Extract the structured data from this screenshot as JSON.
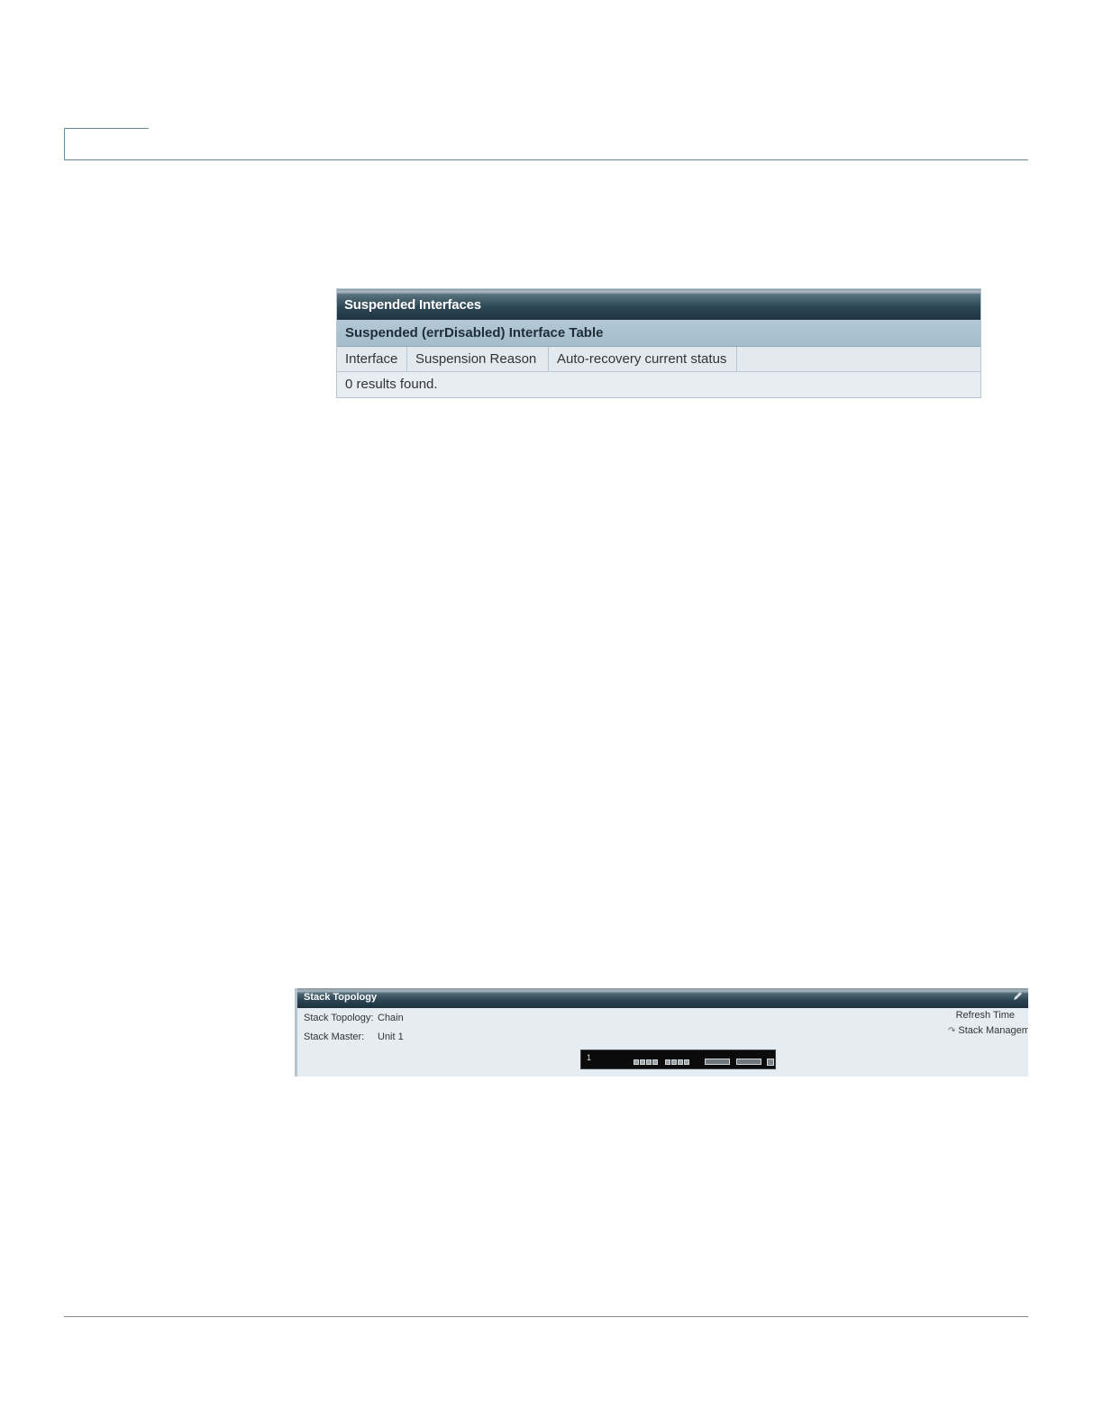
{
  "suspended_panel": {
    "title": "Suspended Interfaces",
    "table_title": "Suspended (errDisabled) Interface Table",
    "columns": [
      "Interface",
      "Suspension Reason",
      "Auto-recovery current status"
    ],
    "empty_message": "0 results found."
  },
  "stack_panel": {
    "title": "Stack Topology",
    "topology_label": "Stack Topology:",
    "topology_value": "Chain",
    "master_label": "Stack Master:",
    "master_value": "Unit 1",
    "refresh_label": "Refresh Time",
    "management_link": "Stack Manageme",
    "unit_number": "1",
    "edit_icon": "pencil-icon",
    "link_icon": "link-icon"
  }
}
